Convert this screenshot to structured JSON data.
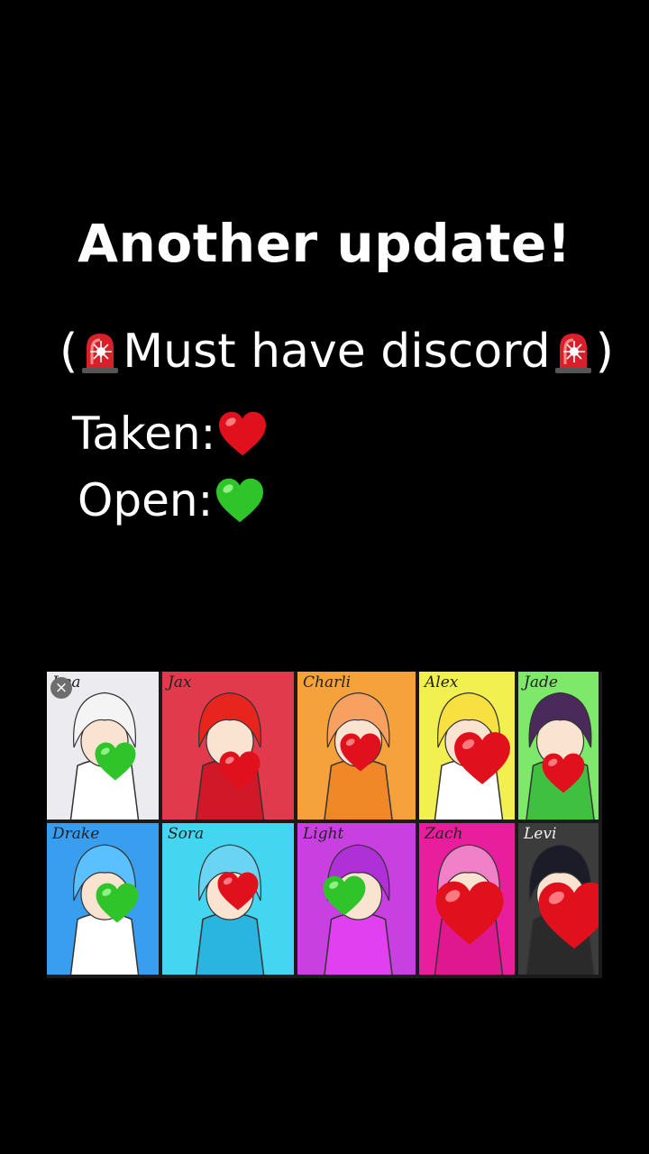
{
  "caption": {
    "title": "Another update!",
    "subtitle_open_paren": "(",
    "subtitle_text": "Must have discord",
    "subtitle_close_paren": ")",
    "taken_label": "Taken:",
    "open_label": "Open:"
  },
  "colors": {
    "taken_heart": "#e0101c",
    "open_heart": "#2fc42a",
    "siren": "#d8202a"
  },
  "icons": {
    "siren": "police-car-light-icon",
    "taken": "red-heart-icon",
    "open": "green-heart-icon",
    "close": "close-icon"
  },
  "characters": [
    {
      "name": "Lea",
      "status": "open",
      "bg": "#ececf0"
    },
    {
      "name": "Jax",
      "status": "taken",
      "bg": "#e03a4c"
    },
    {
      "name": "Charli",
      "status": "taken",
      "bg": "#f5a23c"
    },
    {
      "name": "Alex",
      "status": "taken",
      "bg": "#f2f050"
    },
    {
      "name": "Jade",
      "status": "taken",
      "bg": "#7ee86a"
    },
    {
      "name": "Drake",
      "status": "open",
      "bg": "#3a9ef0"
    },
    {
      "name": "Sora",
      "status": "taken",
      "bg": "#44d6f0"
    },
    {
      "name": "Light",
      "status": "open",
      "bg": "#c840e0"
    },
    {
      "name": "Zach",
      "status": "taken",
      "bg": "#e81e9c"
    },
    {
      "name": "Levi",
      "status": "taken",
      "bg": "#3c3c3c"
    }
  ]
}
